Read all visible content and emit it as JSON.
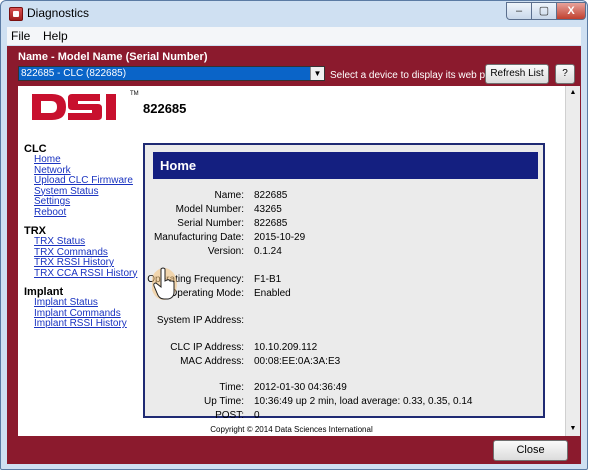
{
  "window": {
    "title": "Diagnostics",
    "min": "–",
    "max": "▢",
    "close": "X"
  },
  "menu": {
    "items": [
      "File",
      "Help"
    ]
  },
  "toolbar": {
    "field_label": "Name - Model Name (Serial Number)",
    "selected_device": "822685 - CLC (822685)",
    "hint": "Select a device to display its web page",
    "refresh_label": "Refresh List",
    "help_label": "?"
  },
  "page": {
    "logo_text": "DSI",
    "trademark": "TM",
    "device_id": "822685",
    "nav": {
      "clc_heading": "CLC",
      "clc_links": [
        "Home",
        "Network",
        "Upload CLC Firmware",
        "System Status",
        "Settings",
        "Reboot"
      ],
      "trx_heading": "TRX",
      "trx_links": [
        "TRX Status",
        "TRX Commands",
        "TRX RSSI History",
        "TRX CCA RSSI History"
      ],
      "implant_heading": "Implant",
      "implant_links": [
        "Implant Status",
        "Implant Commands",
        "Implant RSSI History"
      ]
    },
    "home": {
      "title": "Home",
      "name_label": "Name:",
      "name": "822685",
      "model_label": "Model Number:",
      "model": "43265",
      "serial_label": "Serial Number:",
      "serial": "822685",
      "mfg_label": "Manufacturing Date:",
      "mfg": "2015-10-29",
      "version_label": "Version:",
      "version": "0.1.24",
      "freq_label": "Operating Frequency:",
      "freq": "F1-B1",
      "mode_label": "Operating Mode:",
      "mode": "Enabled",
      "sysip_label": "System IP Address:",
      "sysip": "",
      "clcip_label": "CLC IP Address:",
      "clcip": "10.10.209.112",
      "mac_label": "MAC Address:",
      "mac": "00:08:EE:0A:3A:E3",
      "time_label": "Time:",
      "time": "2012-01-30 04:36:49",
      "uptime_label": "Up Time:",
      "uptime": "10:36:49 up 2 min, load average: 0.33, 0.35, 0.14",
      "post_label": "POST:",
      "post": "0"
    },
    "copyright": "Copyright © 2014 Data Sciences International"
  },
  "footer": {
    "close_label": "Close"
  },
  "colors": {
    "frame": "#8b1a2d",
    "header_bar": "#141f80",
    "link": "#1a33c0",
    "logo": "#c8102e"
  }
}
